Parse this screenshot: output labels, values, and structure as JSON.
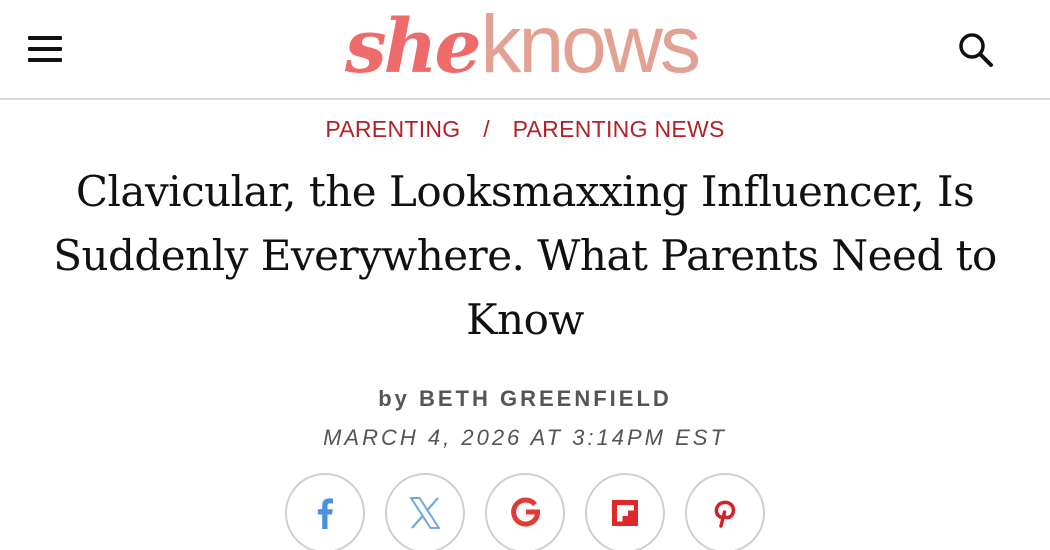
{
  "header": {
    "logo": {
      "part1": "she",
      "part2": "knows"
    },
    "menu_icon": "hamburger-menu-icon",
    "search_icon": "search-icon"
  },
  "breadcrumb": {
    "items": [
      "PARENTING",
      "PARENTING NEWS"
    ],
    "separator": "/"
  },
  "article": {
    "title": "Clavicular, the Looksmaxxing Influencer, Is Suddenly Everywhere. What Parents Need to Know",
    "byline_prefix": "by",
    "author": "BETH GREENFIELD",
    "date": "MARCH 4, 2026 AT 3:14PM EST"
  },
  "share": [
    {
      "icon": "facebook-icon",
      "color": "#4a90e2"
    },
    {
      "icon": "x-twitter-icon",
      "color": "#6fa8dc"
    },
    {
      "icon": "google-icon",
      "color": "#e53935"
    },
    {
      "icon": "flipboard-icon",
      "color": "#e12828"
    },
    {
      "icon": "pinterest-icon",
      "color": "#d62027"
    }
  ],
  "colors": {
    "accent": "#b3202a",
    "logo_she": "#ef6a6a",
    "logo_knows": "#e3a193",
    "meta_text": "#555555"
  }
}
